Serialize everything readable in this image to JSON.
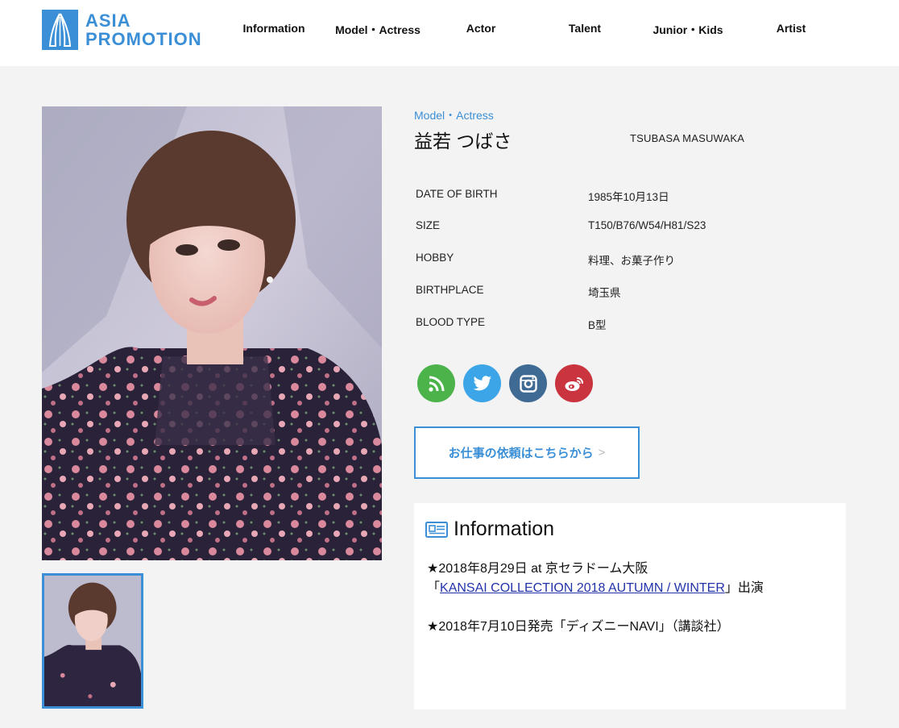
{
  "header": {
    "logo_line1": "ASIA",
    "logo_line2": "PROMOTION",
    "brand_color": "#3a8fd6",
    "nav": [
      {
        "label": "Information"
      },
      {
        "label": "Model・Actress"
      },
      {
        "label": "Actor"
      },
      {
        "label": "Talent"
      },
      {
        "label": "Junior・Kids"
      },
      {
        "label": "Artist"
      }
    ]
  },
  "profile": {
    "category": "Model・Actress",
    "name_jp": "益若 つばさ",
    "name_en": "TSUBASA MASUWAKA",
    "details": [
      {
        "key": "DATE OF BIRTH",
        "value": "1985年10月13日"
      },
      {
        "key": "SIZE",
        "value": "T150/B76/W54/H81/S23"
      },
      {
        "key": "HOBBY",
        "value": "料理、お菓子作り"
      },
      {
        "key": "BIRTHPLACE",
        "value": "埼玉県"
      },
      {
        "key": "BLOOD TYPE",
        "value": "B型"
      }
    ]
  },
  "social": [
    {
      "icon": "rss-icon",
      "color": "#4cb34a"
    },
    {
      "icon": "twitter-icon",
      "color": "#3ba5e8"
    },
    {
      "icon": "instagram-icon",
      "color": "#3f6a94"
    },
    {
      "icon": "weibo-icon",
      "color": "#c9343e"
    }
  ],
  "contact": {
    "label": "お仕事の依頼はこちらから",
    "arrow": ">"
  },
  "information": {
    "title": "Information",
    "item1_line1": "★2018年8月29日 at 京セラドーム大阪",
    "item1_prefix": "「",
    "item1_link": "KANSAI COLLECTION 2018 AUTUMN / WINTER",
    "item1_suffix": "」出演",
    "item2": "★2018年7月10日発売「ディズニーNAVI」（講談社）"
  }
}
